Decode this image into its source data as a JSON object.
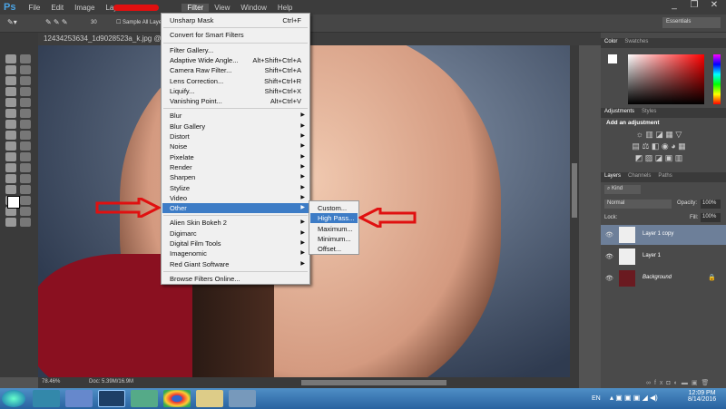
{
  "app": {
    "logo": "Ps"
  },
  "menubar": [
    "File",
    "Edit",
    "Image",
    "Layer",
    "Filter",
    "View",
    "Window",
    "Help"
  ],
  "options": {
    "brush_size": "30",
    "sample_all": "Sample All Layers"
  },
  "document": {
    "tab": "12434253634_1d9028523a_k.jpg @ 78.5%",
    "zoom": "78.46%",
    "doc_size": "Doc: 5.39M/16.9M"
  },
  "filter_menu": [
    {
      "label": "Unsharp Mask",
      "shortcut": "Ctrl+F"
    },
    {
      "sep": true
    },
    {
      "label": "Convert for Smart Filters"
    },
    {
      "sep": true
    },
    {
      "label": "Filter Gallery..."
    },
    {
      "label": "Adaptive Wide Angle...",
      "shortcut": "Alt+Shift+Ctrl+A"
    },
    {
      "label": "Camera Raw Filter...",
      "shortcut": "Shift+Ctrl+A"
    },
    {
      "label": "Lens Correction...",
      "shortcut": "Shift+Ctrl+R"
    },
    {
      "label": "Liquify...",
      "shortcut": "Shift+Ctrl+X"
    },
    {
      "label": "Vanishing Point...",
      "shortcut": "Alt+Ctrl+V"
    },
    {
      "sep": true
    },
    {
      "label": "Blur",
      "sub": true
    },
    {
      "label": "Blur Gallery",
      "sub": true
    },
    {
      "label": "Distort",
      "sub": true
    },
    {
      "label": "Noise",
      "sub": true
    },
    {
      "label": "Pixelate",
      "sub": true
    },
    {
      "label": "Render",
      "sub": true
    },
    {
      "label": "Sharpen",
      "sub": true
    },
    {
      "label": "Stylize",
      "sub": true
    },
    {
      "label": "Video",
      "sub": true
    },
    {
      "label": "Other",
      "sub": true,
      "highlight": true
    },
    {
      "sep": true
    },
    {
      "label": "Alien Skin Bokeh 2",
      "sub": true
    },
    {
      "label": "Digimarc",
      "sub": true
    },
    {
      "label": "Digital Film Tools",
      "sub": true
    },
    {
      "label": "Imagenomic",
      "sub": true
    },
    {
      "label": "Red Giant Software",
      "sub": true
    },
    {
      "sep": true
    },
    {
      "label": "Browse Filters Online..."
    }
  ],
  "other_submenu": [
    {
      "label": "Custom..."
    },
    {
      "label": "High Pass...",
      "highlight": true
    },
    {
      "label": "Maximum..."
    },
    {
      "label": "Minimum..."
    },
    {
      "label": "Offset..."
    }
  ],
  "workspace": "Essentials",
  "panels": {
    "color_tabs": [
      "Color",
      "Swatches"
    ],
    "adjust_tabs": [
      "Adjustments",
      "Styles"
    ],
    "add_adjustment": "Add an adjustment",
    "layer_tabs": [
      "Layers",
      "Channels",
      "Paths"
    ],
    "kind": "Kind",
    "blend": "Normal",
    "opacity_label": "Opacity:",
    "opacity": "100%",
    "lock_label": "Lock:",
    "fill_label": "Fill:",
    "fill": "100%",
    "layers": [
      {
        "name": "Layer 1 copy",
        "selected": true
      },
      {
        "name": "Layer 1"
      },
      {
        "name": "Background",
        "locked": true
      }
    ]
  },
  "taskbar": {
    "lang": "EN",
    "time": "12:09 PM",
    "date": "8/14/2016"
  },
  "colors": {
    "highlight": "#3d7cc6",
    "arrow": "#e01010"
  }
}
